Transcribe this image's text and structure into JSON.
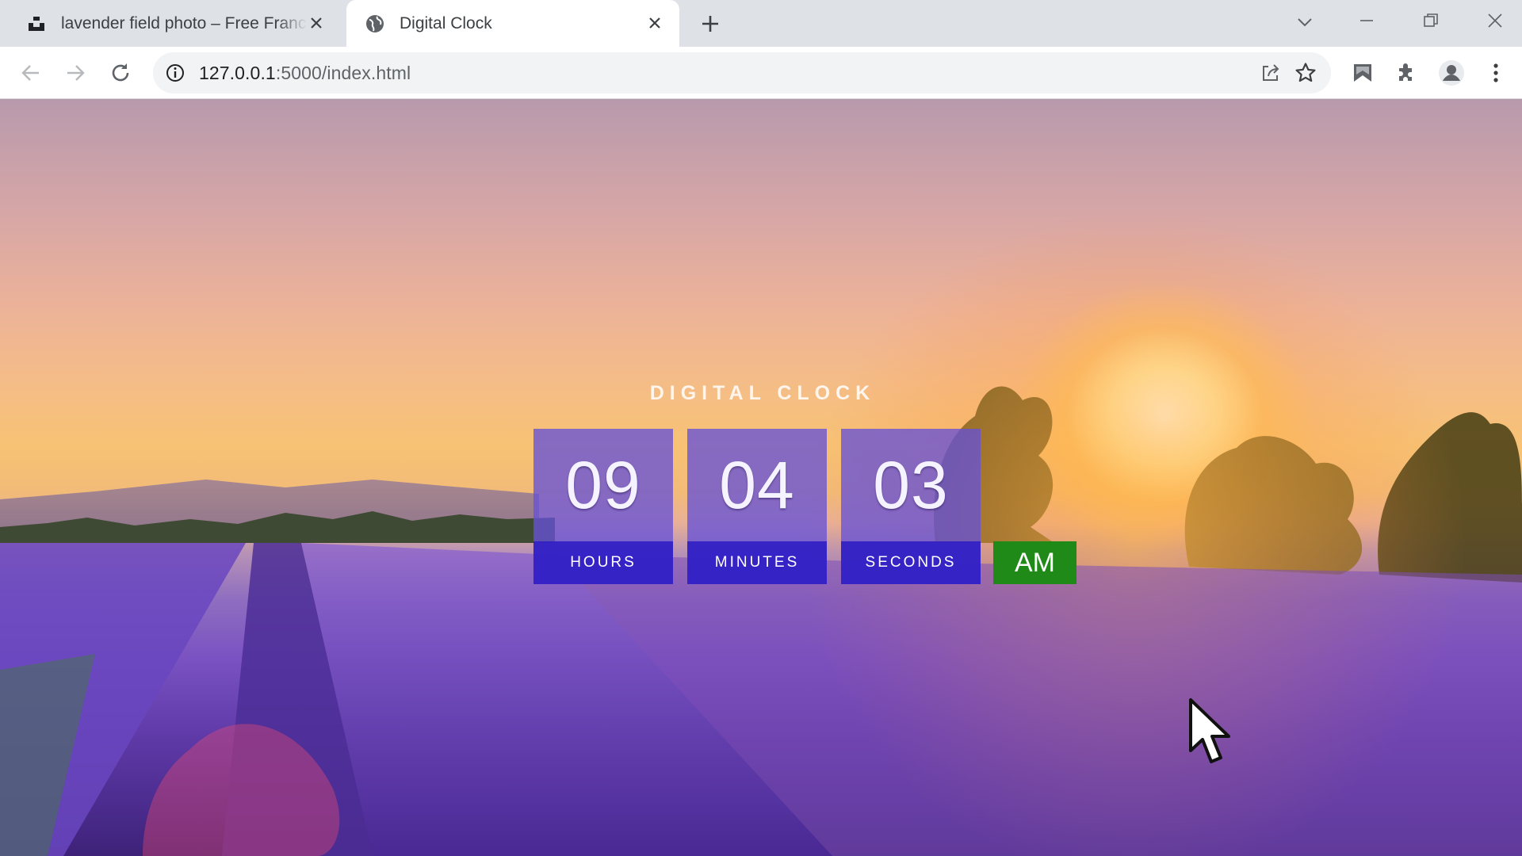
{
  "browser": {
    "tabs": [
      {
        "title": "lavender field photo – Free France",
        "favicon": "unsplash-logo-icon",
        "active": false
      },
      {
        "title": "Digital Clock",
        "favicon": "globe-icon",
        "active": true
      }
    ],
    "address_bar": {
      "host": "127.0.0.1",
      "path": ":5000/index.html"
    }
  },
  "page": {
    "title": "DIGITAL CLOCK",
    "clock": {
      "hours": "09",
      "minutes": "04",
      "seconds": "03",
      "hours_label": "HOURS",
      "minutes_label": "MINUTES",
      "seconds_label": "SECONDS",
      "period": "AM"
    }
  },
  "colors": {
    "unit_background": "#6752d6",
    "label_background": "#301ec4",
    "period_background": "#1f8a17"
  }
}
